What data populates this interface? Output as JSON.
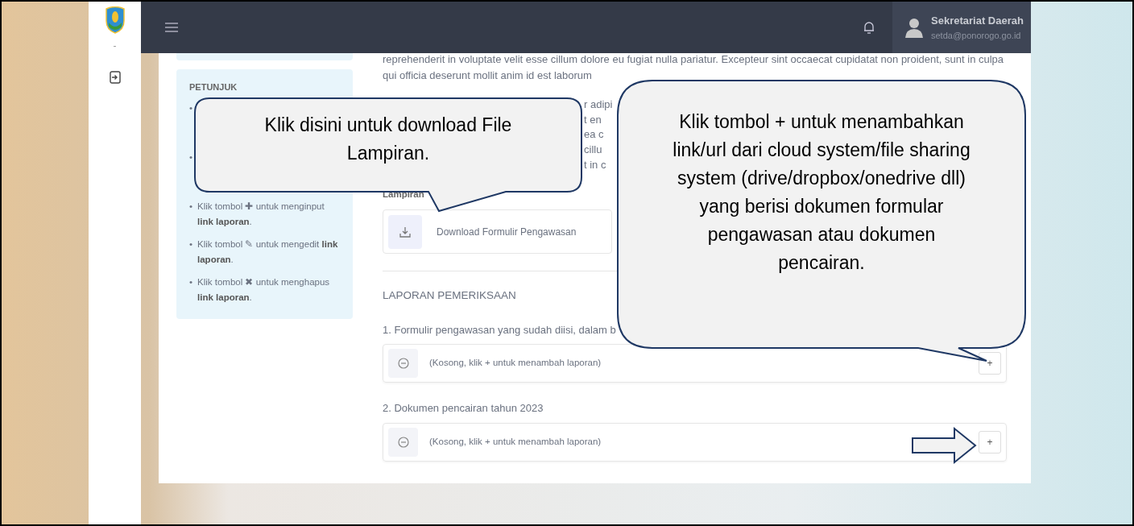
{
  "sidebar": {
    "caption": "-"
  },
  "navbar": {
    "user": {
      "name": "Sekretariat Daerah",
      "email": "setda@ponorogo.go.id"
    }
  },
  "petunjuk": {
    "title": "PETUNJUK",
    "items": [
      {
        "kind": "covered",
        "marker": "•"
      },
      {
        "kind": "covered",
        "marker": "•"
      },
      {
        "kind": "text",
        "marker": "•",
        "text": "Klik tombol ✚ untuk menginput **link laporan**."
      },
      {
        "kind": "text",
        "marker": "•",
        "text": "Klik tombol ✎ untuk mengedit **link laporan**."
      },
      {
        "kind": "text",
        "marker": "•",
        "text": "Klik tombol ✖ untuk menghapus **link laporan**."
      }
    ]
  },
  "content": {
    "paragraph": "reprehenderit in voluptate velit esse cillum dolore eu fugiat nulla pariatur. Excepteur sint occaecat cupidatat non proident, sunt in culpa qui officia deserunt mollit anim id est laborum",
    "covered_paragraph_fragments": [
      "r adipi",
      "t en",
      "ea c",
      "cillu",
      "t in c"
    ],
    "lampiran": {
      "label": "Lampiran",
      "download": "Download Formulir Pengawasan"
    },
    "laporan": {
      "title": "LAPORAN PEMERIKSAAN",
      "items": [
        {
          "label": "1. Formulir pengawasan yang sudah diisi, dalam b",
          "empty_text": "(Kosong, klik + untuk menambah laporan)",
          "add_button": "+"
        },
        {
          "label": "2. Dokumen pencairan tahun 2023",
          "empty_text": "(Kosong, klik + untuk menambah laporan)",
          "add_button": "+"
        }
      ]
    }
  },
  "callouts": [
    {
      "text": "Klik disini untuk download File Lampiran."
    },
    {
      "text": "Klik tombol + untuk menambahkan link/url dari cloud system/file sharing system (drive/dropbox/onedrive dll) yang berisi dokumen formular pengawasan atau dokumen pencairan."
    }
  ]
}
